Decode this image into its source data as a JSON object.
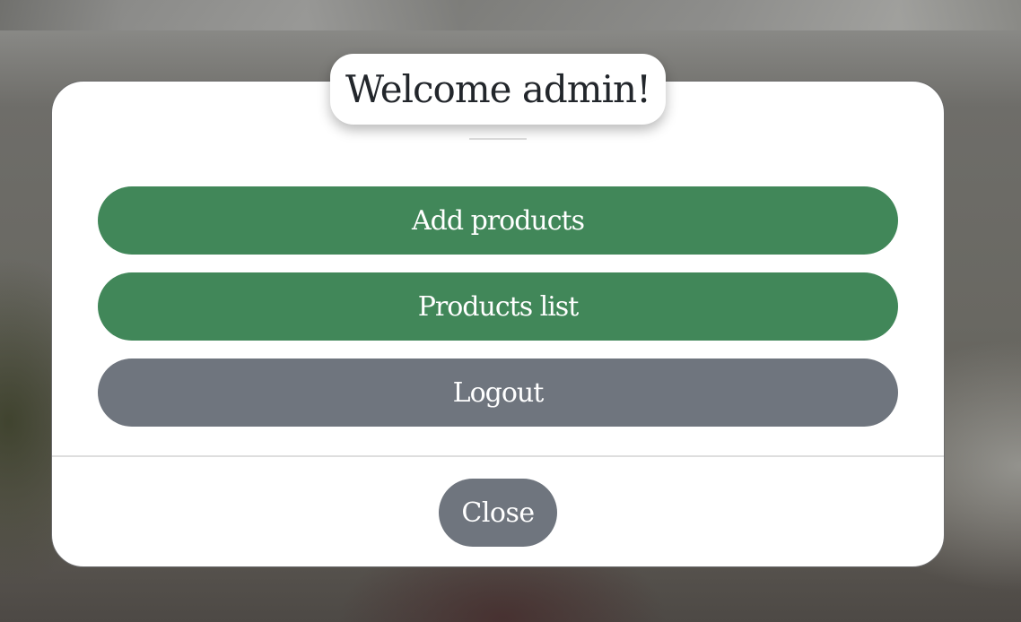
{
  "modal": {
    "title": "Welcome admin!",
    "actions": [
      {
        "label": "Add products",
        "color": "#418759"
      },
      {
        "label": "Products list",
        "color": "#418759"
      },
      {
        "label": "Logout",
        "color": "#6f757e"
      }
    ],
    "close_label": "Close"
  },
  "colors": {
    "primary": "#418759",
    "secondary": "#6f757e",
    "surface": "#ffffff",
    "title_text": "#22262b"
  }
}
